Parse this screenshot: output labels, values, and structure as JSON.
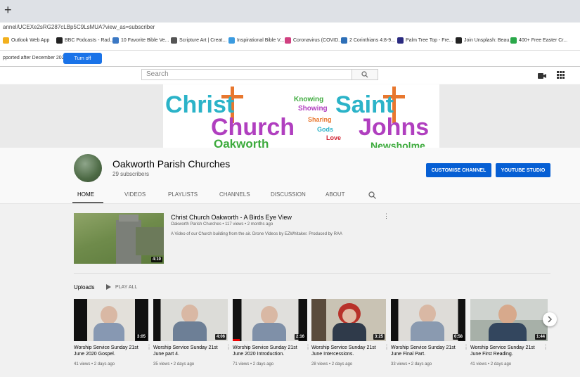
{
  "browser": {
    "new_tab": "+",
    "url": "annel/UCEXe2sRG287cLBp5C9LsMUA?view_as=subscriber",
    "bookmarks": [
      {
        "label": "Outlook Web App",
        "color": "#f2b01e"
      },
      {
        "label": "BBC Podcasts - Rad...",
        "color": "#222222"
      },
      {
        "label": "10 Favorite Bible Ve...",
        "color": "#3b78c4"
      },
      {
        "label": "Scripture Art | Creat...",
        "color": "#555555"
      },
      {
        "label": "Inspirational Bible V...",
        "color": "#3b9be0"
      },
      {
        "label": "Coronavirus (COVID...",
        "color": "#d04080"
      },
      {
        "label": "2 Corinthians 4:8-9...",
        "color": "#2e6fb7"
      },
      {
        "label": "Palm Tree Top - Fre...",
        "color": "#2a2a80"
      },
      {
        "label": "Join Unsplash: Beau...",
        "color": "#222222"
      },
      {
        "label": "400+ Free Easter Cr...",
        "color": "#2aa84a"
      }
    ],
    "info_text": "pported after December 2020.",
    "turn_off": "Turn off"
  },
  "youtube": {
    "search_placeholder": "Search"
  },
  "banner": {
    "words": {
      "christ": "Christ",
      "saint": "Saint",
      "church": "Church",
      "johns": "Johns",
      "oakworth": "Oakworth",
      "newsholme": "Newsholme",
      "knowing": "Knowing",
      "showing": "Showing",
      "sharing": "Sharing",
      "gods": "Gods",
      "love": "Love"
    },
    "colors": {
      "teal": "#2bb3c8",
      "purple": "#b03fbf",
      "green": "#3caa3c",
      "orange": "#e8772e",
      "red": "#d02030"
    }
  },
  "channel": {
    "name": "Oakworth Parish Churches",
    "subscribers": "29 subscribers",
    "customise": "CUSTOMISE CHANNEL",
    "studio": "YOUTUBE STUDIO",
    "tabs": [
      "HOME",
      "VIDEOS",
      "PLAYLISTS",
      "CHANNELS",
      "DISCUSSION",
      "ABOUT"
    ]
  },
  "featured": {
    "title": "Christ Church Oakworth - A Birds Eye View",
    "meta": "Oakworth Parish Churches • 117 views • 2 months ago",
    "description": "A Video of our Church building from the air. Drone Videos by EZWhitaker. Produced by RAA",
    "duration": "4:10"
  },
  "uploads": {
    "heading": "Uploads",
    "play_all": "PLAY ALL",
    "videos": [
      {
        "title": "Worship Service Sunday 21st June 2020 Gospel.",
        "meta": "41 views • 2 days ago",
        "duration": "3:05"
      },
      {
        "title": "Worship Service Sunday 21st June part 4.",
        "meta": "35 views • 2 days ago",
        "duration": "4:06"
      },
      {
        "title": "Worship Service Sunday 21st June 2020 Introduction.",
        "meta": "71 views • 2 days ago",
        "duration": "2:16"
      },
      {
        "title": "Worship Service Sunday 21st June Intercessions.",
        "meta": "28 views • 2 days ago",
        "duration": "3:25"
      },
      {
        "title": "Worship Service Sunday 21st June Final Part.",
        "meta": "33 views • 2 days ago",
        "duration": "0:58"
      },
      {
        "title": "Worship Service Sunday 21st June First Reading.",
        "meta": "41 views • 2 days ago",
        "duration": "1:44"
      }
    ]
  }
}
